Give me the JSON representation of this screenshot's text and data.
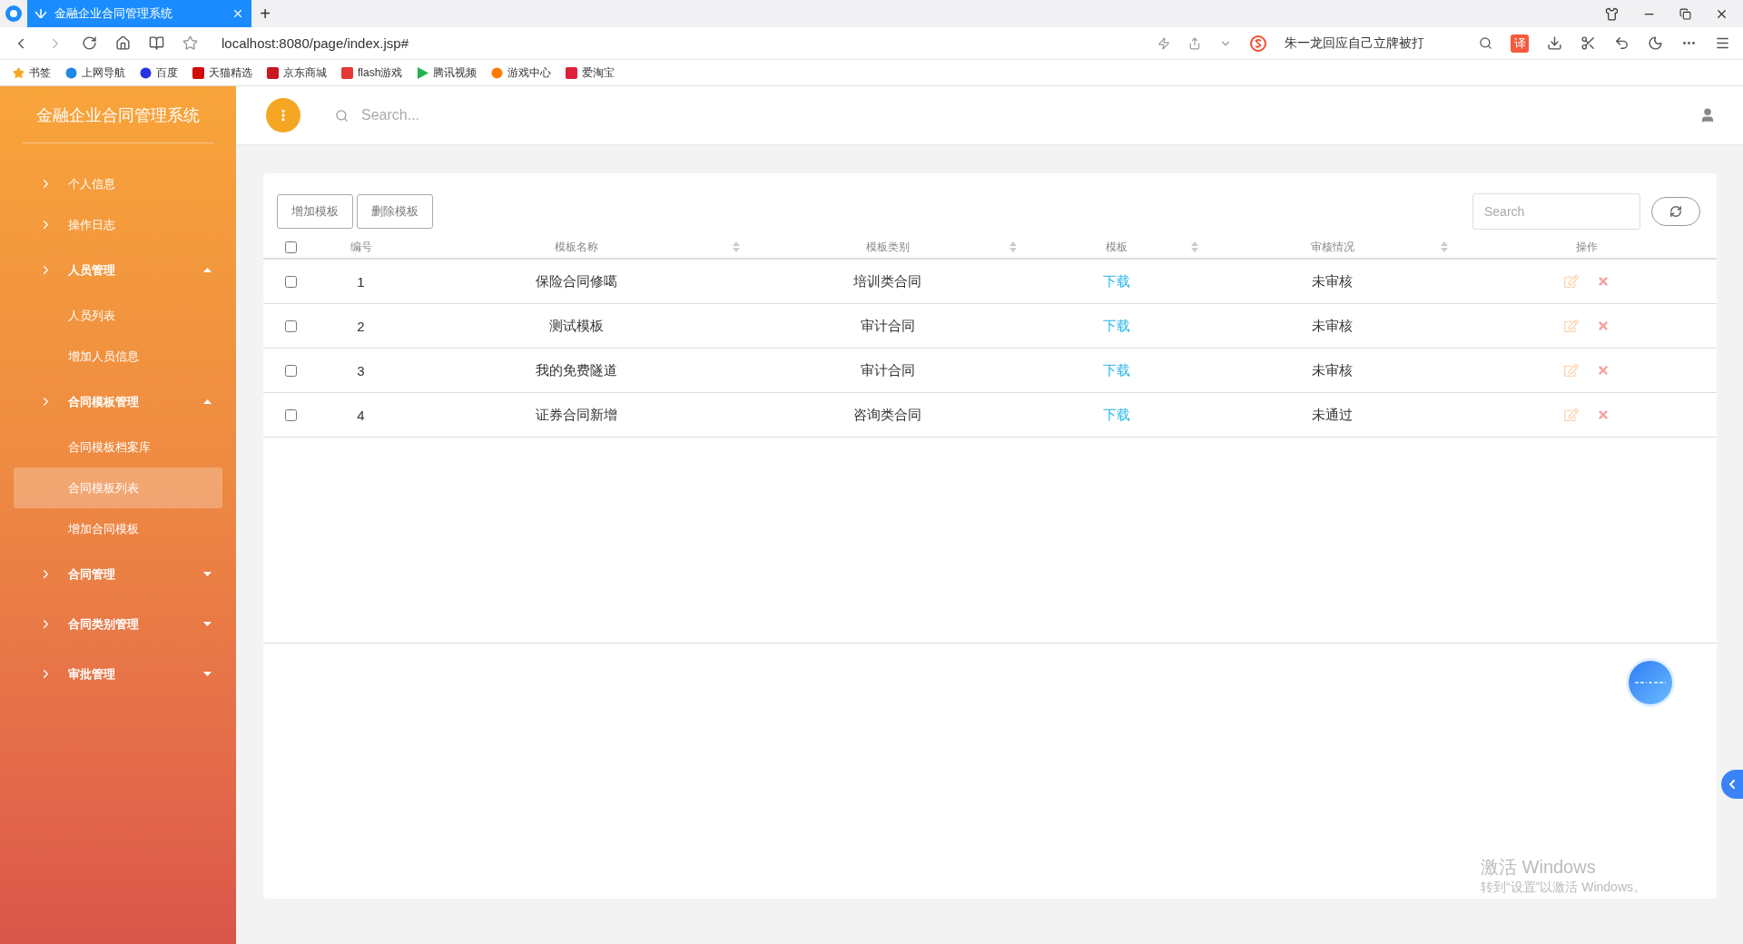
{
  "browser": {
    "tab_title": "金融企业合同管理系统",
    "new_tab": "+",
    "address": "localhost:8080/page/index.jsp#",
    "search_suggestion": "朱一龙回应自己立牌被打",
    "translate_badge": "译",
    "bookmarks": [
      {
        "label": "书签",
        "kind": "star"
      },
      {
        "label": "上网导航",
        "kind": "globe"
      },
      {
        "label": "百度",
        "kind": "paw"
      },
      {
        "label": "天猫精选",
        "kind": "tmall"
      },
      {
        "label": "京东商城",
        "kind": "jd"
      },
      {
        "label": "flash游戏",
        "kind": "flash"
      },
      {
        "label": "腾讯视频",
        "kind": "video"
      },
      {
        "label": "游戏中心",
        "kind": "game"
      },
      {
        "label": "爱淘宝",
        "kind": "taobao"
      }
    ]
  },
  "sidebar": {
    "title": "金融企业合同管理系统",
    "menu": [
      {
        "label": "个人信息",
        "selected": false
      },
      {
        "label": "操作日志",
        "selected": false
      },
      {
        "label": "人员管理",
        "selected": false,
        "expanded": true,
        "children": [
          {
            "label": "人员列表",
            "selected": false
          },
          {
            "label": "增加人员信息",
            "selected": false
          }
        ]
      },
      {
        "label": "合同模板管理",
        "selected": false,
        "expanded": true,
        "children": [
          {
            "label": "合同模板档案库",
            "selected": false
          },
          {
            "label": "合同模板列表",
            "selected": true
          },
          {
            "label": "增加合同模板",
            "selected": false
          }
        ]
      },
      {
        "label": "合同管理",
        "selected": false,
        "expanded": false
      },
      {
        "label": "合同类别管理",
        "selected": false,
        "expanded": false
      },
      {
        "label": "审批管理",
        "selected": false,
        "expanded": false
      }
    ]
  },
  "header": {
    "search_placeholder": "Search..."
  },
  "toolbar": {
    "buttons": [
      "增加模板",
      "删除模板"
    ],
    "search_placeholder": "Search"
  },
  "table": {
    "select_all_checked": false,
    "columns": [
      {
        "label": "编号",
        "sortable": false
      },
      {
        "label": "模板名称",
        "sortable": true
      },
      {
        "label": "模板类别",
        "sortable": true
      },
      {
        "label": "模板",
        "sortable": true
      },
      {
        "label": "审核情况",
        "sortable": true
      },
      {
        "label": "操作",
        "sortable": false
      }
    ],
    "rows": [
      {
        "checked": false,
        "id": "1",
        "name": "保险合同修噶",
        "category": "培训类合同",
        "template": "下载",
        "status": "未审核"
      },
      {
        "checked": false,
        "id": "2",
        "name": "测试模板",
        "category": "审计合同",
        "template": "下载",
        "status": "未审核"
      },
      {
        "checked": false,
        "id": "3",
        "name": "我的免费隧道",
        "category": "审计合同",
        "template": "下载",
        "status": "未审核"
      },
      {
        "checked": false,
        "id": "4",
        "name": "证券合同新增",
        "category": "咨询类合同",
        "template": "下载",
        "status": "未通过"
      }
    ]
  },
  "windows_notice": {
    "title": "激活 Windows",
    "subtitle": "转到“设置”以激活 Windows。"
  }
}
